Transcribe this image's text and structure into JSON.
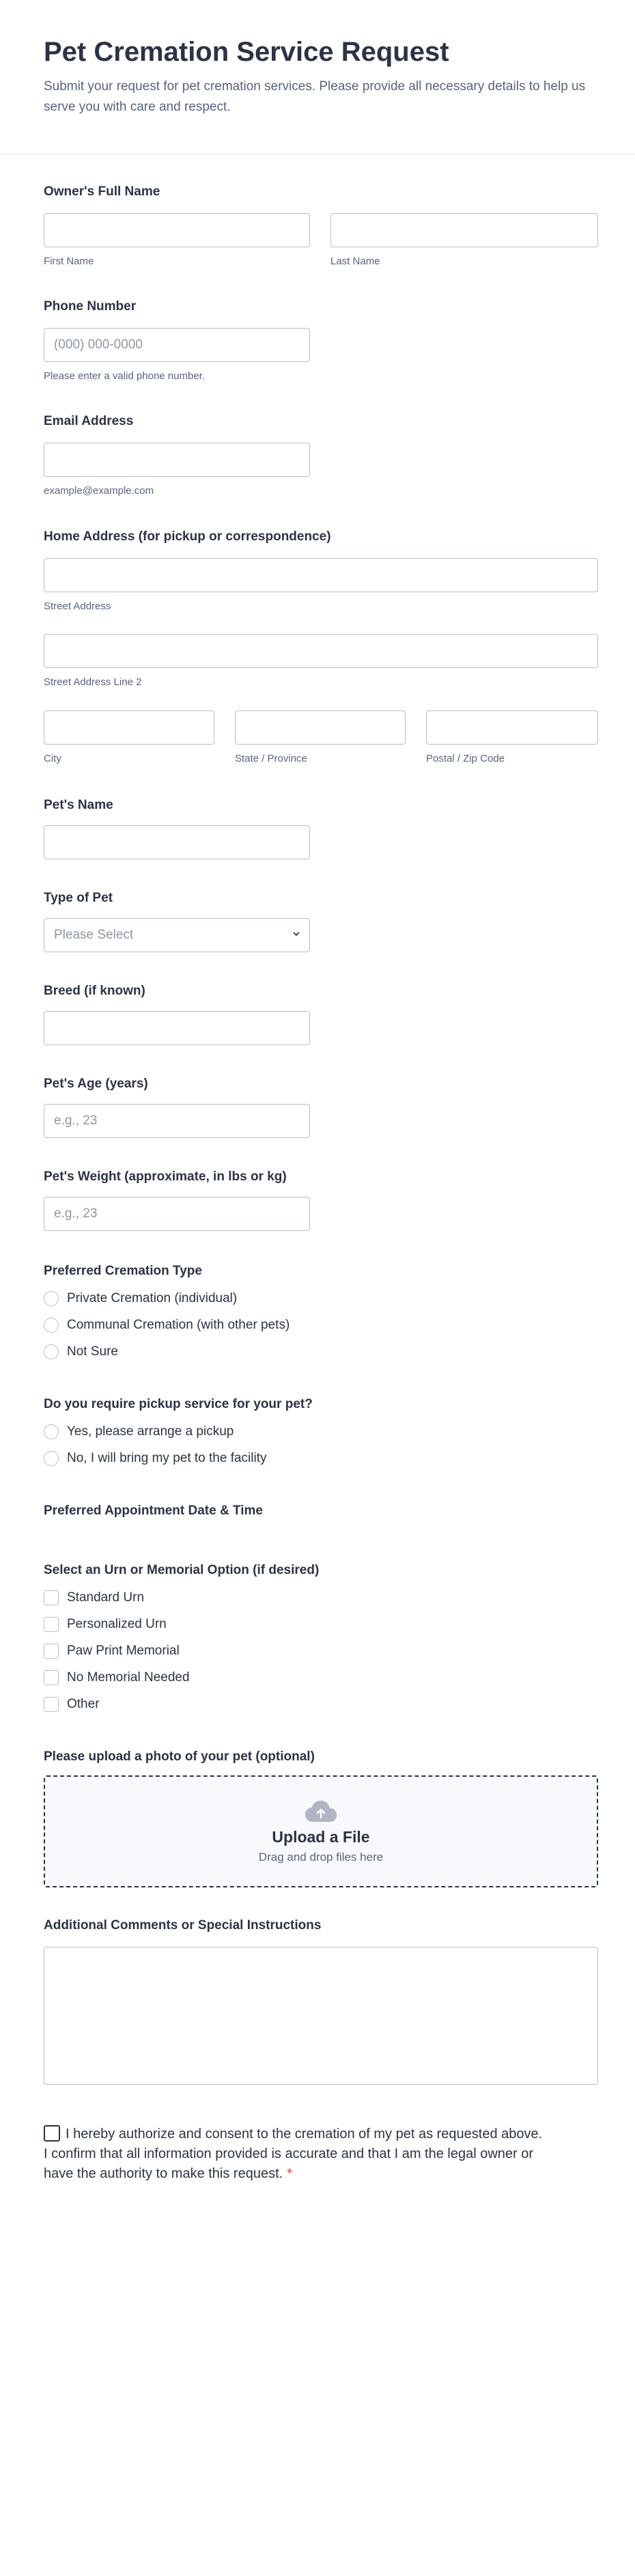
{
  "header": {
    "title": "Pet Cremation Service Request",
    "description": "Submit your request for pet cremation services. Please provide all necessary details to help us serve you with care and respect."
  },
  "owner_name": {
    "label": "Owner's Full Name",
    "first_sub": "First Name",
    "last_sub": "Last Name"
  },
  "phone": {
    "label": "Phone Number",
    "placeholder": "(000) 000-0000",
    "sub": "Please enter a valid phone number."
  },
  "email": {
    "label": "Email Address",
    "sub": "example@example.com"
  },
  "address": {
    "label": "Home Address (for pickup or correspondence)",
    "street_sub": "Street Address",
    "street2_sub": "Street Address Line 2",
    "city_sub": "City",
    "state_sub": "State / Province",
    "zip_sub": "Postal / Zip Code"
  },
  "pet_name": {
    "label": "Pet's Name"
  },
  "pet_type": {
    "label": "Type of Pet",
    "selected": "Please Select"
  },
  "breed": {
    "label": "Breed (if known)"
  },
  "pet_age": {
    "label": "Pet's Age (years)",
    "placeholder": "e.g., 23"
  },
  "pet_weight": {
    "label": "Pet's Weight (approximate, in lbs or kg)",
    "placeholder": "e.g., 23"
  },
  "cremation_type": {
    "label": "Preferred Cremation Type",
    "options": [
      "Private Cremation (individual)",
      "Communal Cremation (with other pets)",
      "Not Sure"
    ]
  },
  "pickup": {
    "label": "Do you require pickup service for your pet?",
    "options": [
      "Yes, please arrange a pickup",
      "No, I will bring my pet to the facility"
    ]
  },
  "appointment": {
    "label": "Preferred Appointment Date & Time"
  },
  "urn": {
    "label": "Select an Urn or Memorial Option (if desired)",
    "options": [
      "Standard Urn",
      "Personalized Urn",
      "Paw Print Memorial",
      "No Memorial Needed",
      "Other"
    ]
  },
  "upload": {
    "label": "Please upload a photo of your pet (optional)",
    "title": "Upload a File",
    "hint": "Drag and drop files here",
    "icon": "cloud-upload-icon"
  },
  "comments": {
    "label": "Additional Comments or Special Instructions"
  },
  "consent": {
    "text": "I hereby authorize and consent to the cremation of my pet as requested above. I confirm that all information provided is accurate and that I am the legal owner or have the authority to make this request.",
    "required_mark": "*"
  },
  "colors": {
    "text": "#2c3345",
    "muted": "#57647e",
    "border": "#b8bdc9",
    "required": "#f23a3c",
    "background": "#f3f3fe"
  }
}
